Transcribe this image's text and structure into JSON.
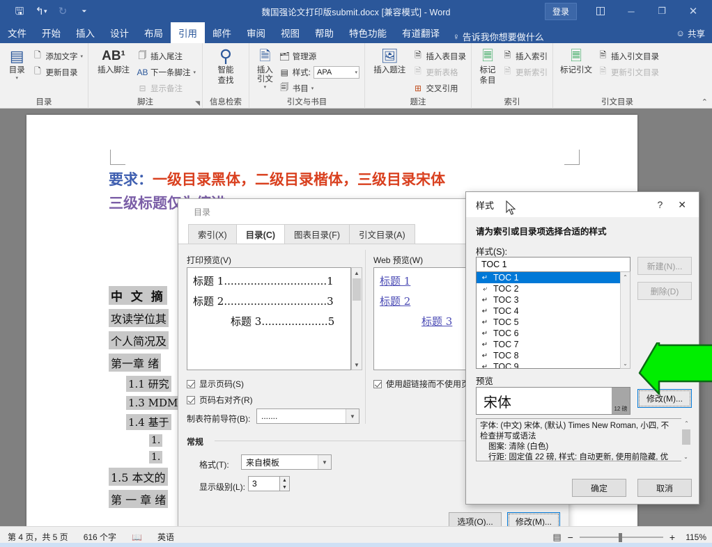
{
  "titlebar": {
    "document_title": "魏国强论文打印版submit.docx [兼容模式]  -  Word",
    "signin_label": "登录",
    "quick_access": [
      "save-icon",
      "undo-icon",
      "redo-icon",
      "customize-qat-icon"
    ],
    "window_buttons": [
      "ribbon-display-options-icon",
      "minimize-icon",
      "restore-icon",
      "close-icon"
    ]
  },
  "tabs": [
    {
      "label": "文件",
      "active": false
    },
    {
      "label": "开始",
      "active": false
    },
    {
      "label": "插入",
      "active": false
    },
    {
      "label": "设计",
      "active": false
    },
    {
      "label": "布局",
      "active": false
    },
    {
      "label": "引用",
      "active": true
    },
    {
      "label": "邮件",
      "active": false
    },
    {
      "label": "审阅",
      "active": false
    },
    {
      "label": "视图",
      "active": false
    },
    {
      "label": "帮助",
      "active": false
    },
    {
      "label": "特色功能",
      "active": false
    },
    {
      "label": "有道翻译",
      "active": false
    }
  ],
  "tell_me": "告诉我你想要做什么",
  "share_label": "共享",
  "ribbon": {
    "groups": [
      {
        "name": "目录",
        "big": {
          "label": "目录",
          "icon": "toc-icon"
        },
        "items": [
          {
            "label": "添加文字",
            "icon": "add-text-icon",
            "caret": true,
            "disabled": false
          },
          {
            "label": "更新目录",
            "icon": "update-toc-icon",
            "caret": false,
            "disabled": false
          }
        ]
      },
      {
        "name": "脚注",
        "big": {
          "label": "插入脚注",
          "icon": "insert-footnote-icon"
        },
        "items": [
          {
            "label": "插入尾注",
            "icon": "insert-endnote-icon",
            "caret": false,
            "disabled": false
          },
          {
            "label": "下一条脚注",
            "icon": "next-footnote-icon",
            "caret": true,
            "disabled": false
          },
          {
            "label": "显示备注",
            "icon": "show-notes-icon",
            "caret": false,
            "disabled": true
          }
        ]
      },
      {
        "name": "信息检索",
        "big": {
          "label": "智能\n查找",
          "label1": "智能",
          "label2": "查找",
          "icon": "smart-lookup-icon"
        },
        "items": []
      },
      {
        "name": "引文与书目",
        "big": {
          "label": "插入引文",
          "icon": "insert-citation-icon"
        },
        "items": [
          {
            "label": "管理源",
            "icon": "manage-sources-icon",
            "caret": false,
            "disabled": false
          },
          {
            "label": "样式:",
            "icon": "style-icon",
            "combo": "APA",
            "disabled": false
          },
          {
            "label": "书目",
            "icon": "bibliography-icon",
            "caret": true,
            "disabled": false
          }
        ]
      },
      {
        "name": "题注",
        "big": {
          "label": "插入题注",
          "icon": "insert-caption-icon"
        },
        "items": [
          {
            "label": "插入表目录",
            "icon": "insert-table-of-figures-icon",
            "caret": false,
            "disabled": false
          },
          {
            "label": "更新表格",
            "icon": "update-table-icon",
            "caret": false,
            "disabled": true
          },
          {
            "label": "交叉引用",
            "icon": "cross-reference-icon",
            "caret": false,
            "disabled": false
          }
        ]
      },
      {
        "name": "索引",
        "big": {
          "label1": "标记",
          "label2": "条目",
          "icon": "mark-entry-icon"
        },
        "items": [
          {
            "label": "插入索引",
            "icon": "insert-index-icon",
            "caret": false,
            "disabled": false
          },
          {
            "label": "更新索引",
            "icon": "update-index-icon",
            "caret": false,
            "disabled": true
          }
        ]
      },
      {
        "name": "引文目录",
        "big": {
          "label": "标记引文",
          "icon": "mark-citation-icon"
        },
        "items": [
          {
            "label": "插入引文目录",
            "icon": "insert-table-of-authorities-icon",
            "caret": false,
            "disabled": false
          },
          {
            "label": "更新引文目录",
            "icon": "update-table-of-authorities-icon",
            "caret": false,
            "disabled": true
          }
        ]
      }
    ]
  },
  "document": {
    "heading_prefix": "要求：",
    "heading_red": "一级目录黑体，二级目录楷体，三级目录宋体",
    "heading_line2": "三级标题仅为缩进",
    "toc_entries": [
      {
        "text": "中 文 摘",
        "level": 0
      },
      {
        "text": "攻读学位其",
        "level": 1
      },
      {
        "text": "个人简况及",
        "level": 1
      },
      {
        "text": "第一章 绪",
        "level": 1
      },
      {
        "text": "1.1 研究",
        "level": 2
      },
      {
        "text": "1.3 MDM",
        "level": 2
      },
      {
        "text": "1.4 基于",
        "level": 2
      },
      {
        "text": "1.",
        "level": 3
      },
      {
        "text": "1.",
        "level": 3
      },
      {
        "text": "1.5 本文的",
        "level": 1
      },
      {
        "text": "第 一 章  绪",
        "level": 1
      }
    ]
  },
  "toc_dialog": {
    "window_title": "目录",
    "tabs": [
      {
        "label": "索引(X)",
        "selected": false
      },
      {
        "label": "目录(C)",
        "selected": true
      },
      {
        "label": "图表目录(F)",
        "selected": false
      },
      {
        "label": "引文目录(A)",
        "selected": false
      }
    ],
    "print_preview_label": "打印预览(V)",
    "print_preview_items": [
      {
        "text": "标题 1",
        "dots": "...............................",
        "page": "1",
        "indent": 0
      },
      {
        "text": "标题 2",
        "dots": "...............................",
        "page": "3",
        "indent": 0
      },
      {
        "text": "标题 3",
        "dots": "....................",
        "page": "5",
        "indent": 1
      }
    ],
    "web_preview_label": "Web 预览(W)",
    "web_preview_items": [
      {
        "text": "标题 1",
        "indent": 0
      },
      {
        "text": "标题 2",
        "indent": 0
      },
      {
        "text": "标题 3",
        "indent": 1
      }
    ],
    "show_page_numbers": {
      "label": "显示页码(S)",
      "checked": true
    },
    "right_align_page_numbers": {
      "label": "页码右对齐(R)",
      "checked": true
    },
    "use_hyperlinks": {
      "label": "使用超链接而不使用页",
      "checked": true
    },
    "tab_leader_label": "制表符前导符(B):",
    "tab_leader_value": ".......",
    "general_label": "常规",
    "format_label": "格式(T):",
    "format_value": "来自模板",
    "show_levels_label": "显示级别(L):",
    "show_levels_value": "3",
    "options_button": "选项(O)...",
    "modify_button": "修改(M)..."
  },
  "style_dialog": {
    "window_title": "样式",
    "help_icon": "?",
    "close_icon": "✕",
    "instruction": "请为索引或目录项选择合适的样式",
    "styles_label": "样式(S):",
    "styles_value": "TOC 1",
    "style_list": [
      {
        "name": "TOC 1",
        "selected": true,
        "glyph": "↵"
      },
      {
        "name": "TOC 2",
        "selected": false,
        "glyph": "⤶"
      },
      {
        "name": "TOC 3",
        "selected": false,
        "glyph": "↵"
      },
      {
        "name": "TOC 4",
        "selected": false,
        "glyph": "↵"
      },
      {
        "name": "TOC 5",
        "selected": false,
        "glyph": "↵"
      },
      {
        "name": "TOC 6",
        "selected": false,
        "glyph": "↵"
      },
      {
        "name": "TOC 7",
        "selected": false,
        "glyph": "↵"
      },
      {
        "name": "TOC 8",
        "selected": false,
        "glyph": "↵"
      },
      {
        "name": "TOC 9",
        "selected": false,
        "glyph": "↵"
      }
    ],
    "new_button": "新建(N)...",
    "delete_button": "删除(D)",
    "preview_label": "预览",
    "preview_font_sample": "宋体",
    "preview_point_size": "12 磅",
    "modify_button": "修改(M)...",
    "description": "字体: (中文) 宋体, (默认) Times New Roman, 小四, 不检查拼写或语法\n   图案: 清除 (白色)\n   行距: 固定值 22 磅, 样式: 自动更新, 使用前隐藏, 优",
    "description_lines": [
      "字体: (中文) 宋体, (默认) Times New Roman, 小四, 不",
      "检查拼写或语法",
      "   图案: 清除 (白色)",
      "   行距: 固定值 22 磅, 样式: 自动更新, 使用前隐藏, 优"
    ],
    "ok_button": "确定",
    "cancel_button": "取消"
  },
  "annotation": {
    "arrow_color": "#00EE00",
    "target": "修改(M)..."
  },
  "statusbar": {
    "page_info": "第 4 页，共 5 页",
    "word_count": "616 个字",
    "proofing_icon": "proofing-icon",
    "language": "英语",
    "view_icons": [
      "read-mode-icon",
      "print-layout-icon",
      "web-layout-icon"
    ],
    "zoom_out": "−",
    "zoom_in": "+",
    "zoom_level": "115%"
  }
}
